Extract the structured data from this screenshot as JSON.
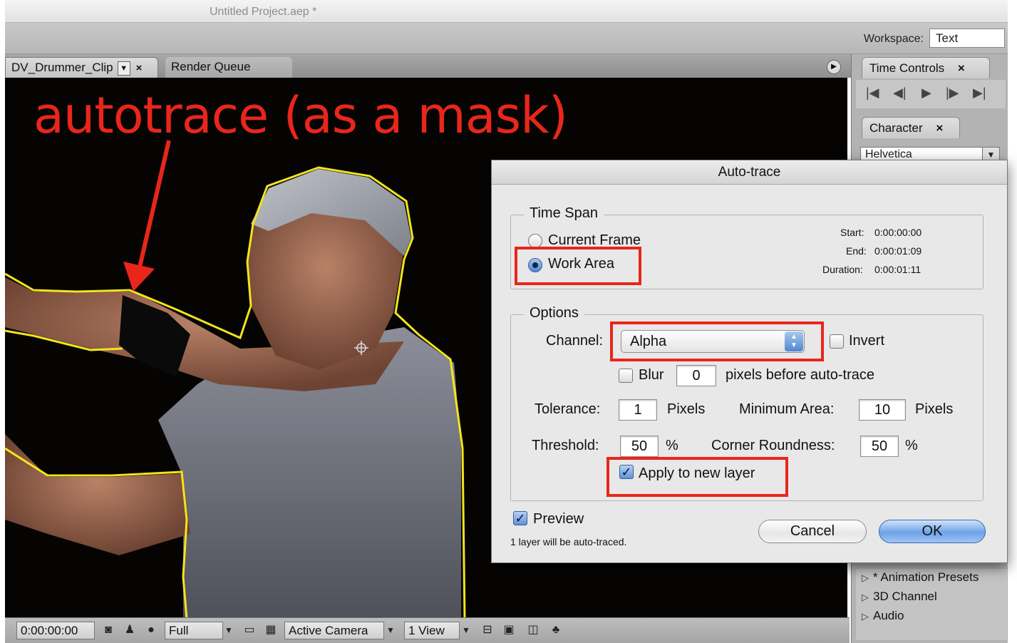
{
  "window": {
    "title": "Untitled Project.aep *"
  },
  "workspace": {
    "label": "Workspace:",
    "value": "Text"
  },
  "comp_panel": {
    "tabs": [
      {
        "label": "DV_Drummer_Clip"
      },
      {
        "label": "Render Queue"
      }
    ],
    "annotation": "autotrace (as a mask)"
  },
  "status_bar": {
    "timecode": "0:00:00:00",
    "resolution": "Full",
    "camera": "Active Camera",
    "views": "1 View"
  },
  "right_panels": {
    "time_controls": {
      "title": "Time Controls"
    },
    "character": {
      "title": "Character",
      "font": "Helvetica"
    },
    "effects": [
      "* Animation Presets",
      "3D Channel",
      "Audio"
    ]
  },
  "dialog": {
    "title": "Auto-trace",
    "time_span": {
      "label": "Time Span",
      "current_frame": "Current Frame",
      "work_area": "Work Area",
      "selected": "Work Area",
      "start_label": "Start:",
      "start_value": "0:00:00:00",
      "end_label": "End:",
      "end_value": "0:00:01:09",
      "duration_label": "Duration:",
      "duration_value": "0:00:01:11"
    },
    "options": {
      "label": "Options",
      "channel_label": "Channel:",
      "channel_value": "Alpha",
      "invert_label": "Invert",
      "invert_checked": false,
      "blur_label": "Blur",
      "blur_checked": false,
      "blur_value": "0",
      "blur_suffix": "pixels before auto-trace",
      "tolerance_label": "Tolerance:",
      "tolerance_value": "1",
      "tolerance_unit": "Pixels",
      "min_area_label": "Minimum Area:",
      "min_area_value": "10",
      "min_area_unit": "Pixels",
      "threshold_label": "Threshold:",
      "threshold_value": "50",
      "threshold_unit": "%",
      "corner_label": "Corner Roundness:",
      "corner_value": "50",
      "corner_unit": "%",
      "apply_label": "Apply to new layer",
      "apply_checked": true
    },
    "preview_label": "Preview",
    "preview_checked": true,
    "info": "1 layer will be auto-traced.",
    "cancel": "Cancel",
    "ok": "OK"
  },
  "colors": {
    "annotation_red": "#e8261b",
    "trace_outline": "#f2e51c",
    "viewer_bg": "#050403"
  }
}
